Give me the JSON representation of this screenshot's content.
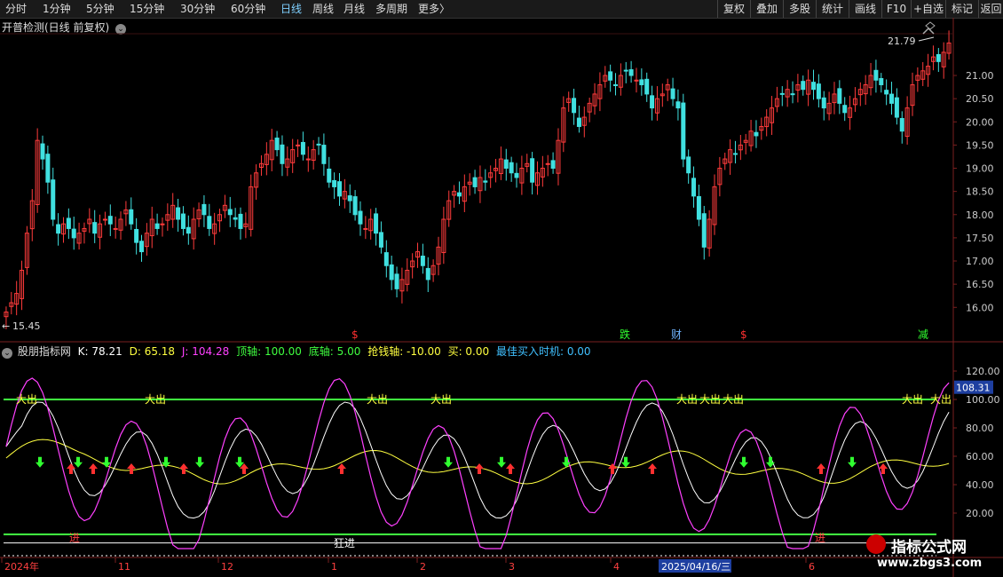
{
  "toolbar": {
    "periods": [
      "分时",
      "1分钟",
      "5分钟",
      "15分钟",
      "30分钟",
      "60分钟",
      "日线",
      "周线",
      "月线",
      "多周期",
      "更多"
    ],
    "active_period": "日线",
    "more_arrow": "〉",
    "actions": [
      "复权",
      "叠加",
      "多股",
      "统计",
      "画线",
      "F10",
      "+自选",
      "返回"
    ]
  },
  "main_panel": {
    "title": "开普检测(日线 前复权)",
    "high_label": "21.79",
    "low_label": "15.45",
    "price_ticks": [
      "21.00",
      "20.50",
      "20.00",
      "19.50",
      "19.00",
      "18.50",
      "18.00",
      "17.50",
      "17.00",
      "16.50",
      "16.00"
    ],
    "events": [
      {
        "text": "$",
        "color": "#ff3030"
      },
      {
        "text": "跌",
        "color": "#30ff30"
      },
      {
        "text": "财",
        "color": "#6fb4ff"
      },
      {
        "text": "$",
        "color": "#ff3030"
      },
      {
        "text": "减",
        "color": "#30ff30"
      }
    ]
  },
  "indicator": {
    "name": "股朋指标网",
    "fields": [
      {
        "label": "K: 78.21",
        "color": "#ffffff"
      },
      {
        "label": "D: 65.18",
        "color": "#ffff40"
      },
      {
        "label": "J: 104.28",
        "color": "#ff40ff"
      },
      {
        "label": "顶轴: 100.00",
        "color": "#40ff40"
      },
      {
        "label": "底轴: 5.00",
        "color": "#40ff40"
      },
      {
        "label": "抢钱轴: -10.00",
        "color": "#ffff40"
      },
      {
        "label": "买: 0.00",
        "color": "#ffff40"
      },
      {
        "label": "最佳买入时机: 0.00",
        "color": "#40c0ff"
      }
    ],
    "ticks": [
      "120.00",
      "100.00",
      "80.00",
      "60.00",
      "40.00",
      "20.00"
    ],
    "current_value": "108.31",
    "sell_text": "大出",
    "buy_text": "进",
    "buy_text2": "狂进"
  },
  "dates": {
    "labels": [
      "2024年",
      "11",
      "12",
      "1",
      "2",
      "3",
      "4",
      "6"
    ],
    "cursor": "2025/04/16/三"
  },
  "watermark": {
    "title": "指标公式网",
    "url": "www.zbgs3.com"
  },
  "colors": {
    "up": "#ff3b3b",
    "down": "#40e0e0",
    "grid": "#7a1f1f",
    "kline": "#ffffff",
    "dline": "#ffff40",
    "jline": "#ff40ff",
    "axis": "#40ff40"
  }
}
